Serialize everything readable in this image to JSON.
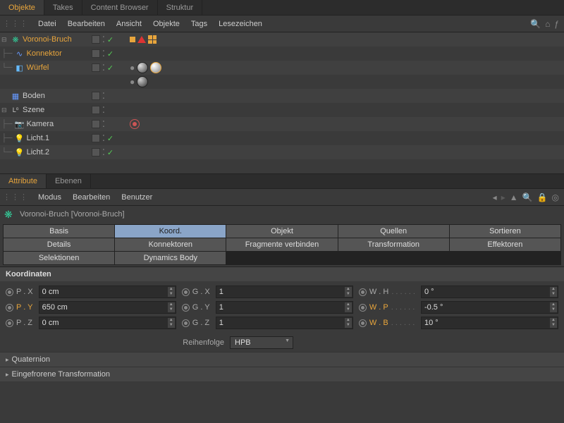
{
  "top_tabs": {
    "objekte": "Objekte",
    "takes": "Takes",
    "content": "Content Browser",
    "struktur": "Struktur"
  },
  "menu1": {
    "datei": "Datei",
    "bearbeiten": "Bearbeiten",
    "ansicht": "Ansicht",
    "objekte": "Objekte",
    "tags": "Tags",
    "lesezeichen": "Lesezeichen"
  },
  "tree": {
    "voronoi": "Voronoi-Bruch",
    "konnektor": "Konnektor",
    "wuerfel": "Würfel",
    "boden": "Boden",
    "szene": "Szene",
    "kamera": "Kamera",
    "licht1": "Licht.1",
    "licht2": "Licht.2"
  },
  "attr_tabs": {
    "attribute": "Attribute",
    "ebenen": "Ebenen"
  },
  "menu2": {
    "modus": "Modus",
    "bearbeiten": "Bearbeiten",
    "benutzer": "Benutzer"
  },
  "header_text": "Voronoi-Bruch [Voronoi-Bruch]",
  "atabs": {
    "basis": "Basis",
    "koord": "Koord.",
    "objekt": "Objekt",
    "quellen": "Quellen",
    "sortieren": "Sortieren",
    "details": "Details",
    "konnektoren": "Konnektoren",
    "fragmente": "Fragmente verbinden",
    "transformation": "Transformation",
    "effektoren": "Effektoren",
    "selektionen": "Selektionen",
    "dynamics": "Dynamics Body"
  },
  "section_koord": "Koordinaten",
  "labels": {
    "px": "P . X",
    "py": "P . Y",
    "pz": "P . Z",
    "gx": "G . X",
    "gy": "G . Y",
    "gz": "G . Z",
    "wh": "W . H",
    "wp": "W . P",
    "wb": "W . B",
    "reihenfolge": "Reihenfolge"
  },
  "values": {
    "px": "0 cm",
    "py": "650 cm",
    "pz": "0 cm",
    "gx": "1",
    "gy": "1",
    "gz": "1",
    "wh": "0 °",
    "wp": "-0.5 °",
    "wb": "10 °",
    "reihenfolge": "HPB"
  },
  "collapse": {
    "quaternion": "Quaternion",
    "eingefroren": "Eingefrorene Transformation"
  }
}
